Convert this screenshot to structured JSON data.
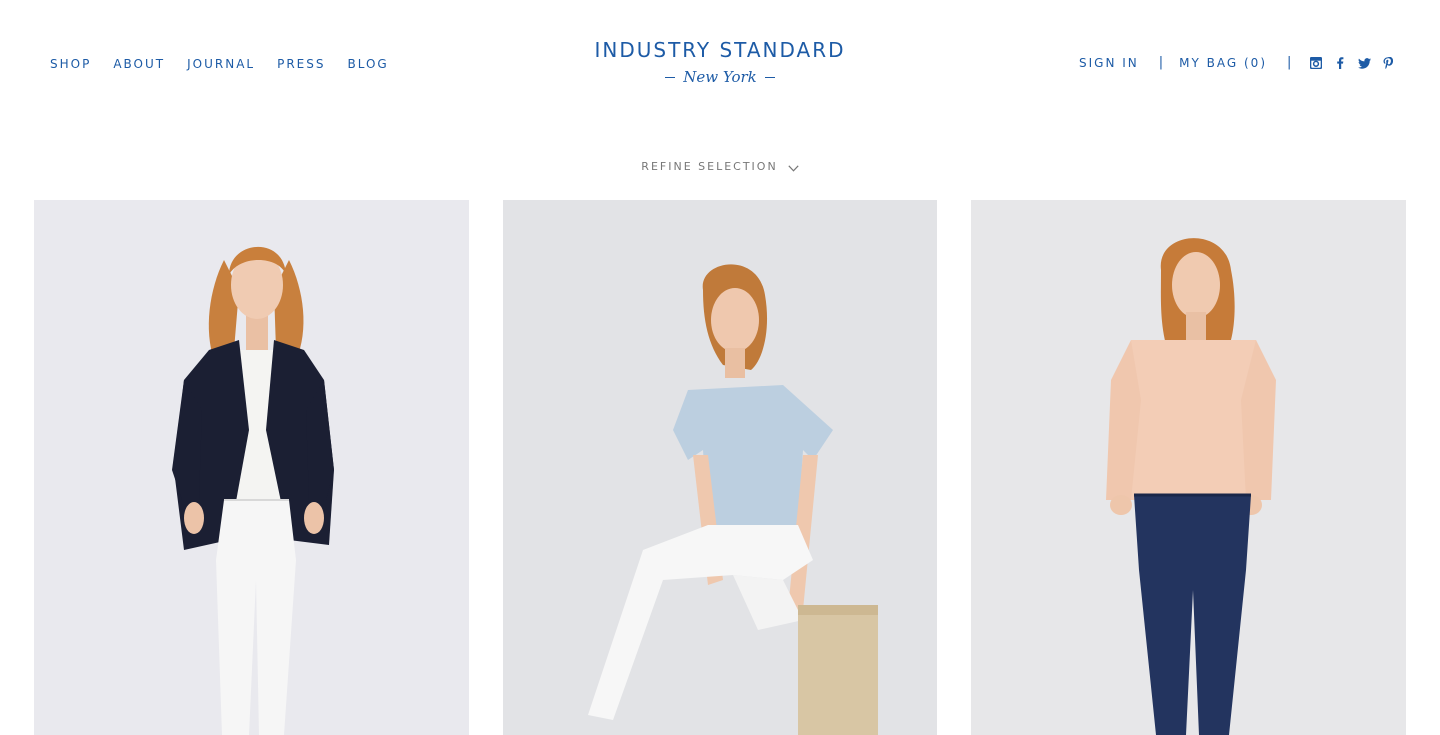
{
  "nav": {
    "items": [
      {
        "label": "SHOP"
      },
      {
        "label": "ABOUT"
      },
      {
        "label": "JOURNAL"
      },
      {
        "label": "PRESS"
      },
      {
        "label": "BLOG"
      }
    ]
  },
  "logo": {
    "title": "INDUSTRY STANDARD",
    "subtitle": "New York"
  },
  "account": {
    "sign_in": "SIGN IN",
    "separator": "|",
    "bag": "MY BAG (0)"
  },
  "social": [
    "instagram-icon",
    "facebook-icon",
    "twitter-icon",
    "pinterest-icon"
  ],
  "refine": {
    "label": "REFINE SELECTION"
  },
  "products": [
    {
      "image": "model-navy-blazer-white-jeans"
    },
    {
      "image": "model-light-blue-tee-white-jeans-seated"
    },
    {
      "image": "model-peach-sweater-dark-jeans"
    }
  ],
  "colors": {
    "brand_blue": "#1d5ba6",
    "refine_gray": "#777777"
  }
}
